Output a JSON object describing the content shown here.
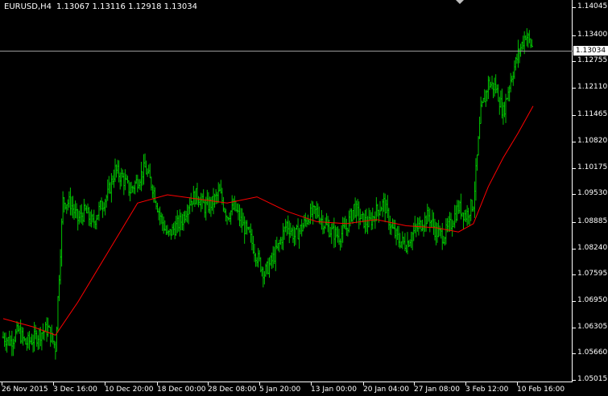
{
  "title": {
    "symbol": "EURUSD,H4",
    "ohlc": "1.13067 1.13116 1.12918 1.13034"
  },
  "current_price": "1.13034",
  "colors": {
    "background": "#000000",
    "bars": "#00c000",
    "moving_average": "#ff0000",
    "axes": "#ffffff",
    "current_price_line": "#9a9a9a"
  },
  "price_axis": [
    "1.14045",
    "1.13400",
    "1.12755",
    "1.12110",
    "1.11465",
    "1.10820",
    "1.10175",
    "1.09530",
    "1.08885",
    "1.08240",
    "1.07595",
    "1.06950",
    "1.06305",
    "1.05660",
    "1.05015"
  ],
  "time_axis": [
    "26 Nov 2015",
    "3 Dec 16:00",
    "10 Dec 20:00",
    "18 Dec 00:00",
    "28 Dec 08:00",
    "5 Jan 20:00",
    "13 Jan 00:00",
    "20 Jan 04:00",
    "27 Jan 08:00",
    "3 Feb 12:00",
    "10 Feb 16:00"
  ],
  "chart_data": {
    "type": "ohlc-bar",
    "timeframe": "H4",
    "ylim": [
      1.05015,
      1.14045
    ],
    "shows_price_series": "close",
    "close_path": [
      [
        0,
        1.0605
      ],
      [
        1,
        1.0595
      ],
      [
        2,
        1.062
      ],
      [
        3,
        1.059
      ],
      [
        4,
        1.06
      ],
      [
        5,
        1.0615
      ],
      [
        6,
        1.0625
      ],
      [
        7,
        1.058
      ],
      [
        8,
        1.0935
      ],
      [
        9,
        1.093
      ],
      [
        10,
        1.089
      ],
      [
        11,
        1.091
      ],
      [
        12,
        1.088
      ],
      [
        13,
        1.092
      ],
      [
        14,
        1.095
      ],
      [
        15,
        1.101
      ],
      [
        16,
        1.099
      ],
      [
        17,
        1.096
      ],
      [
        18,
        1.0985
      ],
      [
        19,
        1.1015
      ],
      [
        20,
        1.097
      ],
      [
        21,
        1.09
      ],
      [
        22,
        1.085
      ],
      [
        23,
        1.087
      ],
      [
        24,
        1.089
      ],
      [
        25,
        1.0935
      ],
      [
        26,
        1.095
      ],
      [
        27,
        1.092
      ],
      [
        28,
        1.093
      ],
      [
        29,
        1.0955
      ],
      [
        30,
        1.09
      ],
      [
        31,
        1.092
      ],
      [
        32,
        1.088
      ],
      [
        33,
        1.085
      ],
      [
        34,
        1.08
      ],
      [
        35,
        1.076
      ],
      [
        36,
        1.079
      ],
      [
        37,
        1.083
      ],
      [
        38,
        1.088
      ],
      [
        39,
        1.085
      ],
      [
        40,
        1.087
      ],
      [
        41,
        1.09
      ],
      [
        42,
        1.091
      ],
      [
        43,
        1.088
      ],
      [
        44,
        1.086
      ],
      [
        45,
        1.085
      ],
      [
        46,
        1.087
      ],
      [
        47,
        1.092
      ],
      [
        48,
        1.089
      ],
      [
        49,
        1.088
      ],
      [
        50,
        1.091
      ],
      [
        51,
        1.093
      ],
      [
        52,
        1.087
      ],
      [
        53,
        1.084
      ],
      [
        54,
        1.083
      ],
      [
        55,
        1.086
      ],
      [
        56,
        1.088
      ],
      [
        57,
        1.09
      ],
      [
        58,
        1.086
      ],
      [
        59,
        1.085
      ],
      [
        60,
        1.088
      ],
      [
        61,
        1.092
      ],
      [
        62,
        1.09
      ],
      [
        63,
        1.093
      ],
      [
        64,
        1.115
      ],
      [
        65,
        1.122
      ],
      [
        66,
        1.121
      ],
      [
        67,
        1.115
      ],
      [
        68,
        1.123
      ],
      [
        69,
        1.129
      ],
      [
        70,
        1.134
      ],
      [
        71,
        1.1303
      ]
    ],
    "moving_average": [
      [
        0,
        1.065
      ],
      [
        4,
        1.063
      ],
      [
        7,
        1.061
      ],
      [
        10,
        1.069
      ],
      [
        14,
        1.081
      ],
      [
        18,
        1.093
      ],
      [
        22,
        1.095
      ],
      [
        26,
        1.094
      ],
      [
        30,
        1.093
      ],
      [
        34,
        1.0945
      ],
      [
        38,
        1.091
      ],
      [
        42,
        1.0885
      ],
      [
        46,
        1.088
      ],
      [
        50,
        1.089
      ],
      [
        54,
        1.0875
      ],
      [
        58,
        1.087
      ],
      [
        61,
        1.086
      ],
      [
        63,
        1.088
      ],
      [
        65,
        1.097
      ],
      [
        67,
        1.104
      ],
      [
        69,
        1.11
      ],
      [
        71,
        1.1165
      ]
    ]
  }
}
